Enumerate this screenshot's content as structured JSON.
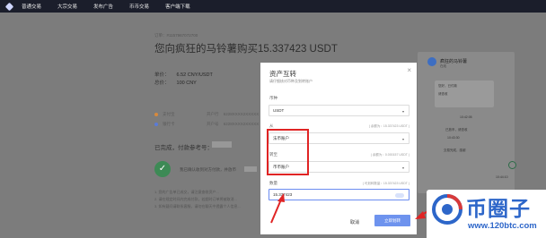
{
  "nav": {
    "items": [
      "普通交易",
      "大宗交易",
      "发布广告",
      "币币交易",
      "客户端下载"
    ]
  },
  "order": {
    "order_no": "订单：#1157967072700",
    "title": "您向疯狂的马铃薯购买15.337423 USDT",
    "price_label": "单价：",
    "price_value": "6.52 CNY/USDT",
    "total_label": "总价：",
    "total_value": "100 CNY",
    "pay_methods": [
      {
        "name": "支付宝",
        "account_label": "开户行",
        "account": "6228XXXX2XXXXX",
        "color": "#d88a3c"
      },
      {
        "name": "银行卡",
        "account_label": "开户号",
        "account": "6228XXXX2XXXXX",
        "color": "#5a7bd8"
      }
    ],
    "done_title": "已完成，付款参考号：",
    "confirm_text": "我已确认收到对方付款，并放币",
    "notes": [
      "1. 您的广告单已成交，请注意查收资产...",
      "2. 请在规定时间内完成付款，若超时订单将被取消...",
      "3. 如有疑问请联系客服，请勿在聊天中透露个人信息..."
    ]
  },
  "chat": {
    "name": "疯狂的马铃薯",
    "status": "在线",
    "messages": [
      "您好，已付款",
      "请查收",
      "已放币，请查收",
      "交易完成，感谢"
    ],
    "times": [
      "10:41:12",
      "10:42:05",
      "10:43:30",
      "10:44:10"
    ]
  },
  "modal": {
    "title": "资产互转",
    "subtitle": "请仔细核对币种及划转账户",
    "close": "×",
    "coin_label": "币种",
    "coin_value": "USDT",
    "from_label": "从",
    "from_hint": "( 余额为：15.337423 USDT )",
    "from_value": "法币账户",
    "to_label": "转至",
    "to_hint": "( 余额为：0.000157 USDT )",
    "to_value": "币币账户",
    "amount_label": "数量",
    "amount_hint": "( 可划转数量：15.337423 USDT )",
    "amount_value": "15.337423",
    "cancel_label": "取消",
    "ok_label": "立即划转"
  },
  "watermark": {
    "text": "币圈子",
    "url": "www.120btc.com"
  },
  "colors": {
    "nav_bg": "#1b1e2b",
    "primary": "#6e93ee",
    "annotation_red": "#e02424",
    "watermark_blue": "#2d66c9"
  }
}
